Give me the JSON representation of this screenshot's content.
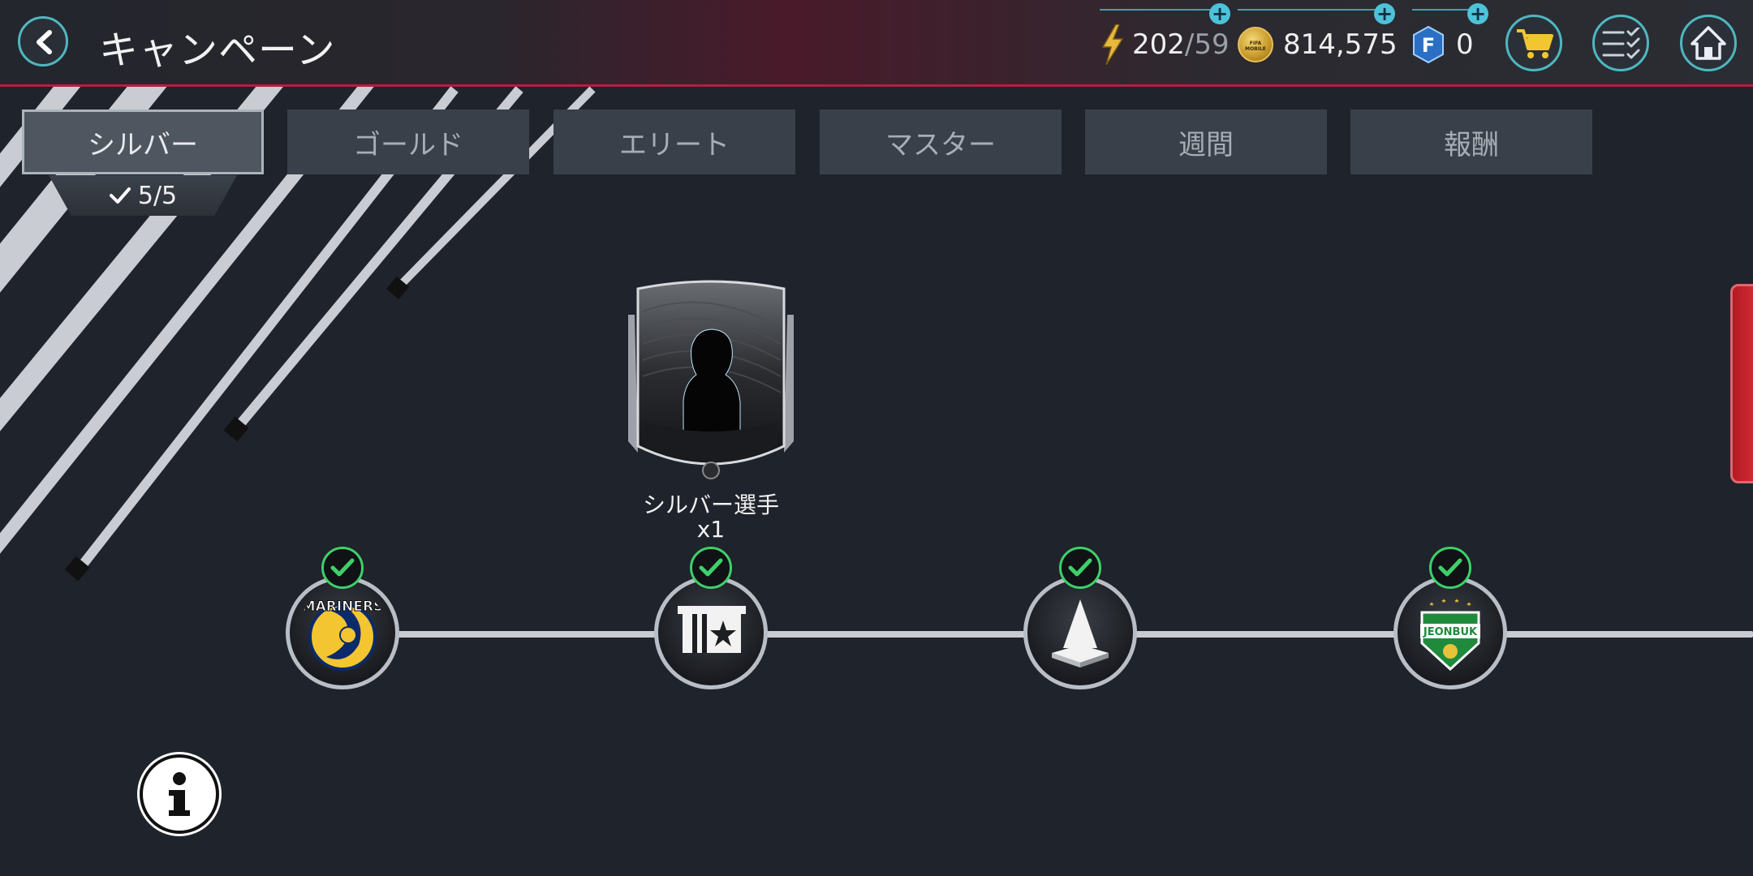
{
  "header": {
    "title": "キャンペーン",
    "stamina_current": "202",
    "stamina_max": "/59",
    "coins": "814,575",
    "fifa_points": "0",
    "coin_logo_text": "FIFA MOBILE",
    "fp_letter": "F",
    "plus_symbol": "+"
  },
  "tabs": [
    {
      "label": "シルバー",
      "active": true
    },
    {
      "label": "ゴールド",
      "active": false
    },
    {
      "label": "エリート",
      "active": false
    },
    {
      "label": "マスター",
      "active": false
    },
    {
      "label": "週間",
      "active": false
    },
    {
      "label": "報酬",
      "active": false
    }
  ],
  "progress": {
    "completed": 5,
    "total": 5,
    "text": "5/5"
  },
  "reward": {
    "name": "シルバー選手",
    "quantity": "x1"
  },
  "nodes": [
    {
      "name": "central-coast-mariners",
      "text": "MARINERS",
      "completed": true
    },
    {
      "name": "gift-box",
      "completed": true
    },
    {
      "name": "training-cone",
      "completed": true
    },
    {
      "name": "jeonbuk",
      "text": "JEONBUK",
      "completed": true
    }
  ],
  "colors": {
    "background": "#1f232c",
    "accent": "#4fb7c0",
    "check": "#3ed06a",
    "topbar_line": "#b0213f"
  }
}
